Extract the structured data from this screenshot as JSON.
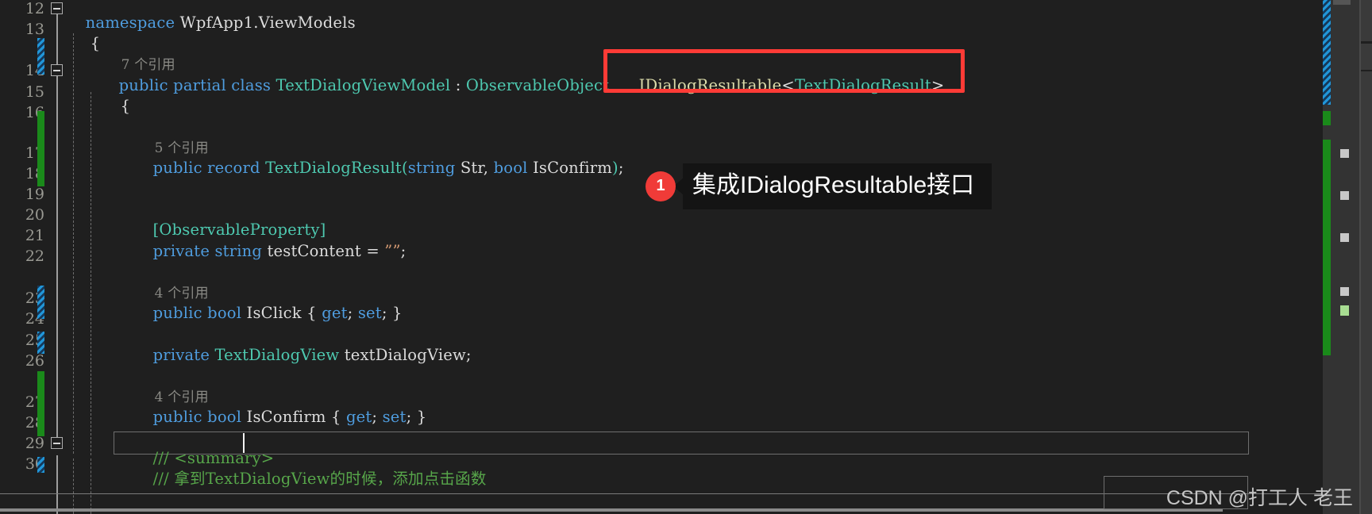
{
  "editor": {
    "language": "csharp",
    "theme_bg": "#1f1f1f",
    "accent_red": "#ff3b36",
    "accent_green": "#1a8a1a",
    "accent_blue": "#2196d8"
  },
  "line_numbers": [
    "12",
    "13",
    "14",
    "15",
    "16",
    "17",
    "18",
    "19",
    "20",
    "21",
    "22",
    "23",
    "24",
    "25",
    "26",
    "27",
    "28",
    "29",
    "30"
  ],
  "code": {
    "l12_namespace_kw": "namespace",
    "l12_namespace_name": " WpfApp1.ViewModels",
    "l13_brace": "{",
    "ref7": "7 个引用",
    "l14_public": "public",
    "l14_partial": " partial",
    "l14_class": " class",
    "l14_typename": " TextDialogViewModel",
    "l14_colon": " : ",
    "l14_base": "ObservableObject",
    "l15_brace": "{",
    "highlight_interface": "IDialogResultable",
    "highlight_generic_open": "<",
    "highlight_generic_arg": "TextDialogResult",
    "highlight_generic_close": ">",
    "ref5": "5 个引用",
    "l17_public": "public",
    "l17_record": " record",
    "l17_name": " TextDialogResult",
    "l17_paren_open": "(",
    "l17_string_kw": "string",
    "l17_str_param": " Str",
    "l17_comma": ", ",
    "l17_bool_kw": "bool",
    "l17_bool_param": " IsConfirm",
    "l17_paren_close": ")",
    "l17_semi": ";",
    "l20_attribute": "[ObservableProperty]",
    "l21_private": "private",
    "l21_string": " string",
    "l21_field": " testContent",
    "l21_eq": " = ",
    "l21_value": "””",
    "l21_semi": ";",
    "ref4a": "4 个引用",
    "l23_public": "public",
    "l23_bool": " bool",
    "l23_name": " IsClick",
    "l23_open": " { ",
    "l23_get": "get",
    "l23_semi1": "; ",
    "l23_set": "set",
    "l23_semi2": "; ",
    "l23_close": "}",
    "l25_private": "private",
    "l25_type": " TextDialogView",
    "l25_field": " textDialogView",
    "l25_semi": ";",
    "ref4b": "4 个引用",
    "l27_public": "public",
    "l27_bool": " bool",
    "l27_name": " IsConfirm",
    "l27_open": " { ",
    "l27_get": "get",
    "l27_semi1": "; ",
    "l27_set": "set",
    "l27_semi2": "; ",
    "l27_close": "}",
    "l29_comment": "/// <summary>",
    "l30_comment": "/// 拿到TextDialogView的时候，添加点击函数"
  },
  "callout": {
    "number": "1",
    "text": "集成IDialogResultable接口"
  },
  "watermark": {
    "text": "CSDN @打工人 老王"
  },
  "icons": {
    "collapse": "collapse-minus-icon",
    "expand": "expand-icon"
  }
}
